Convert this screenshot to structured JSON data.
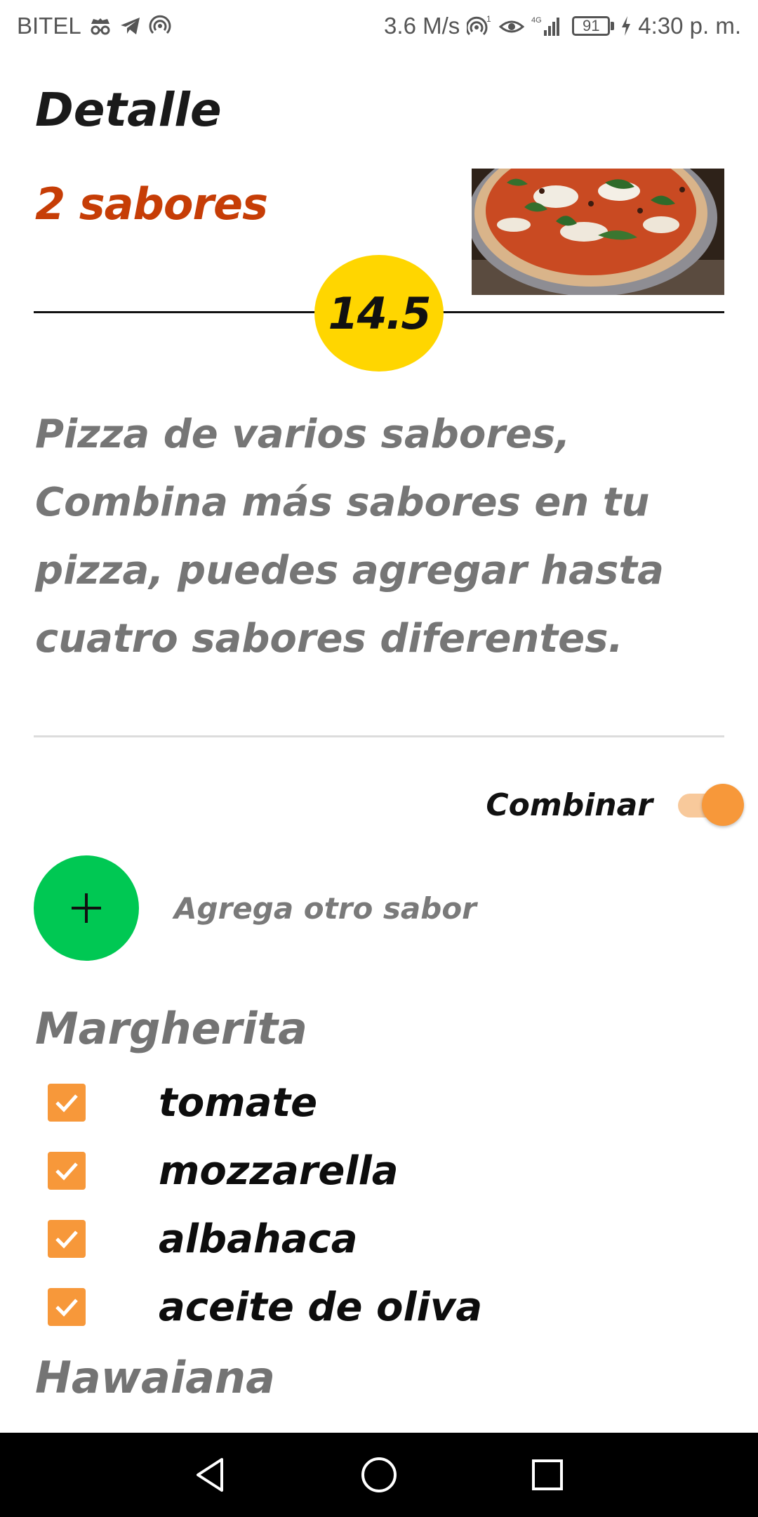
{
  "status_bar": {
    "carrier": "BITEL",
    "speed": "3.6 M/s",
    "hotspot_sup": "1",
    "network": "4G",
    "battery": "91",
    "time": "4:30 p. m."
  },
  "header": {
    "title": "Detalle"
  },
  "product": {
    "name": "2 sabores",
    "price": "14.5",
    "description": "Pizza de varios sabores, Combina más sabores en tu pizza, puedes agregar hasta cuatro sabores diferentes."
  },
  "combine": {
    "label": "Combinar",
    "enabled": true
  },
  "add_flavor": {
    "label": "Agrega otro sabor"
  },
  "flavors": [
    {
      "name": "Margherita",
      "ingredients": [
        {
          "label": "tomate",
          "checked": true
        },
        {
          "label": "mozzarella",
          "checked": true
        },
        {
          "label": "albahaca",
          "checked": true
        },
        {
          "label": "aceite de oliva",
          "checked": true
        }
      ]
    },
    {
      "name": "Hawaiana",
      "ingredients": []
    }
  ],
  "colors": {
    "accent_orange": "#f7983a",
    "price_badge": "#ffd600",
    "add_button": "#00c853",
    "subtitle": "#c63d06"
  },
  "icons": {
    "status": [
      "incognito-icon",
      "telegram-icon",
      "hotspot-icon",
      "eye-icon",
      "signal-icon",
      "battery-icon",
      "charging-icon"
    ],
    "nav": [
      "back-icon",
      "home-icon",
      "recents-icon"
    ]
  }
}
